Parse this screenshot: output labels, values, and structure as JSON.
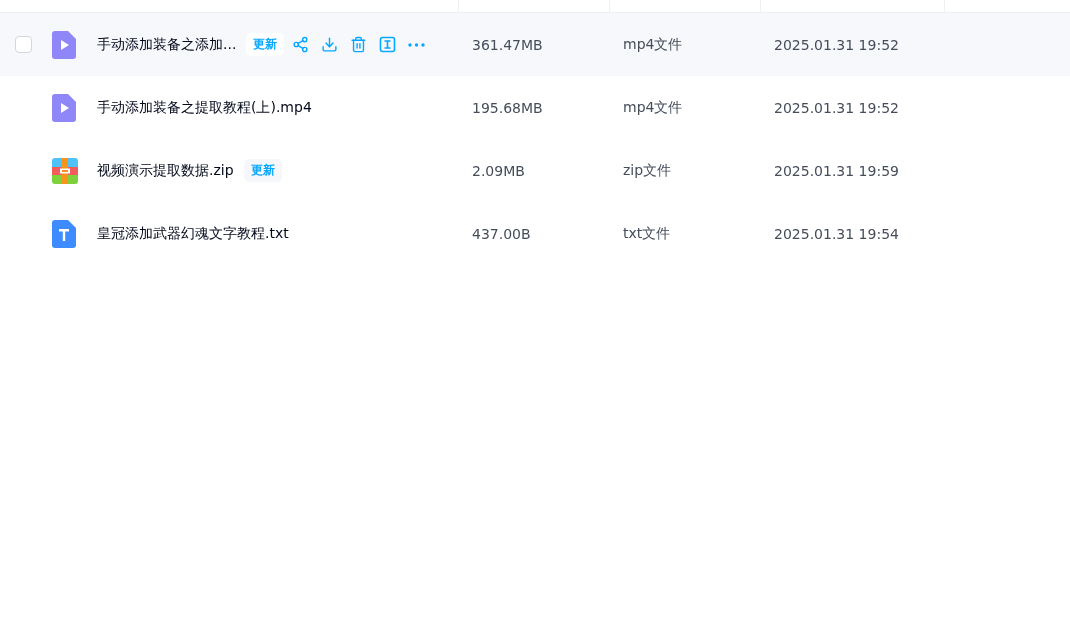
{
  "files": [
    {
      "kind": "video",
      "name": "手动添加装备之添加...",
      "badge": "更新",
      "size": "361.47MB",
      "type": "mp4文件",
      "date": "2025.01.31 19:52",
      "highlighted": true,
      "checked": false
    },
    {
      "kind": "video",
      "name": "手动添加装备之提取教程(上).mp4",
      "size": "195.68MB",
      "type": "mp4文件",
      "date": "2025.01.31 19:52",
      "highlighted": false,
      "checked": false
    },
    {
      "kind": "zip",
      "name": "视频演示提取数据.zip",
      "badge": "更新",
      "size": "2.09MB",
      "type": "zip文件",
      "date": "2025.01.31 19:59",
      "highlighted": false,
      "checked": false
    },
    {
      "kind": "text",
      "name": "皇冠添加武器幻魂文字教程.txt",
      "size": "437.00B",
      "type": "txt文件",
      "date": "2025.01.31 19:54",
      "highlighted": false,
      "checked": false
    }
  ]
}
